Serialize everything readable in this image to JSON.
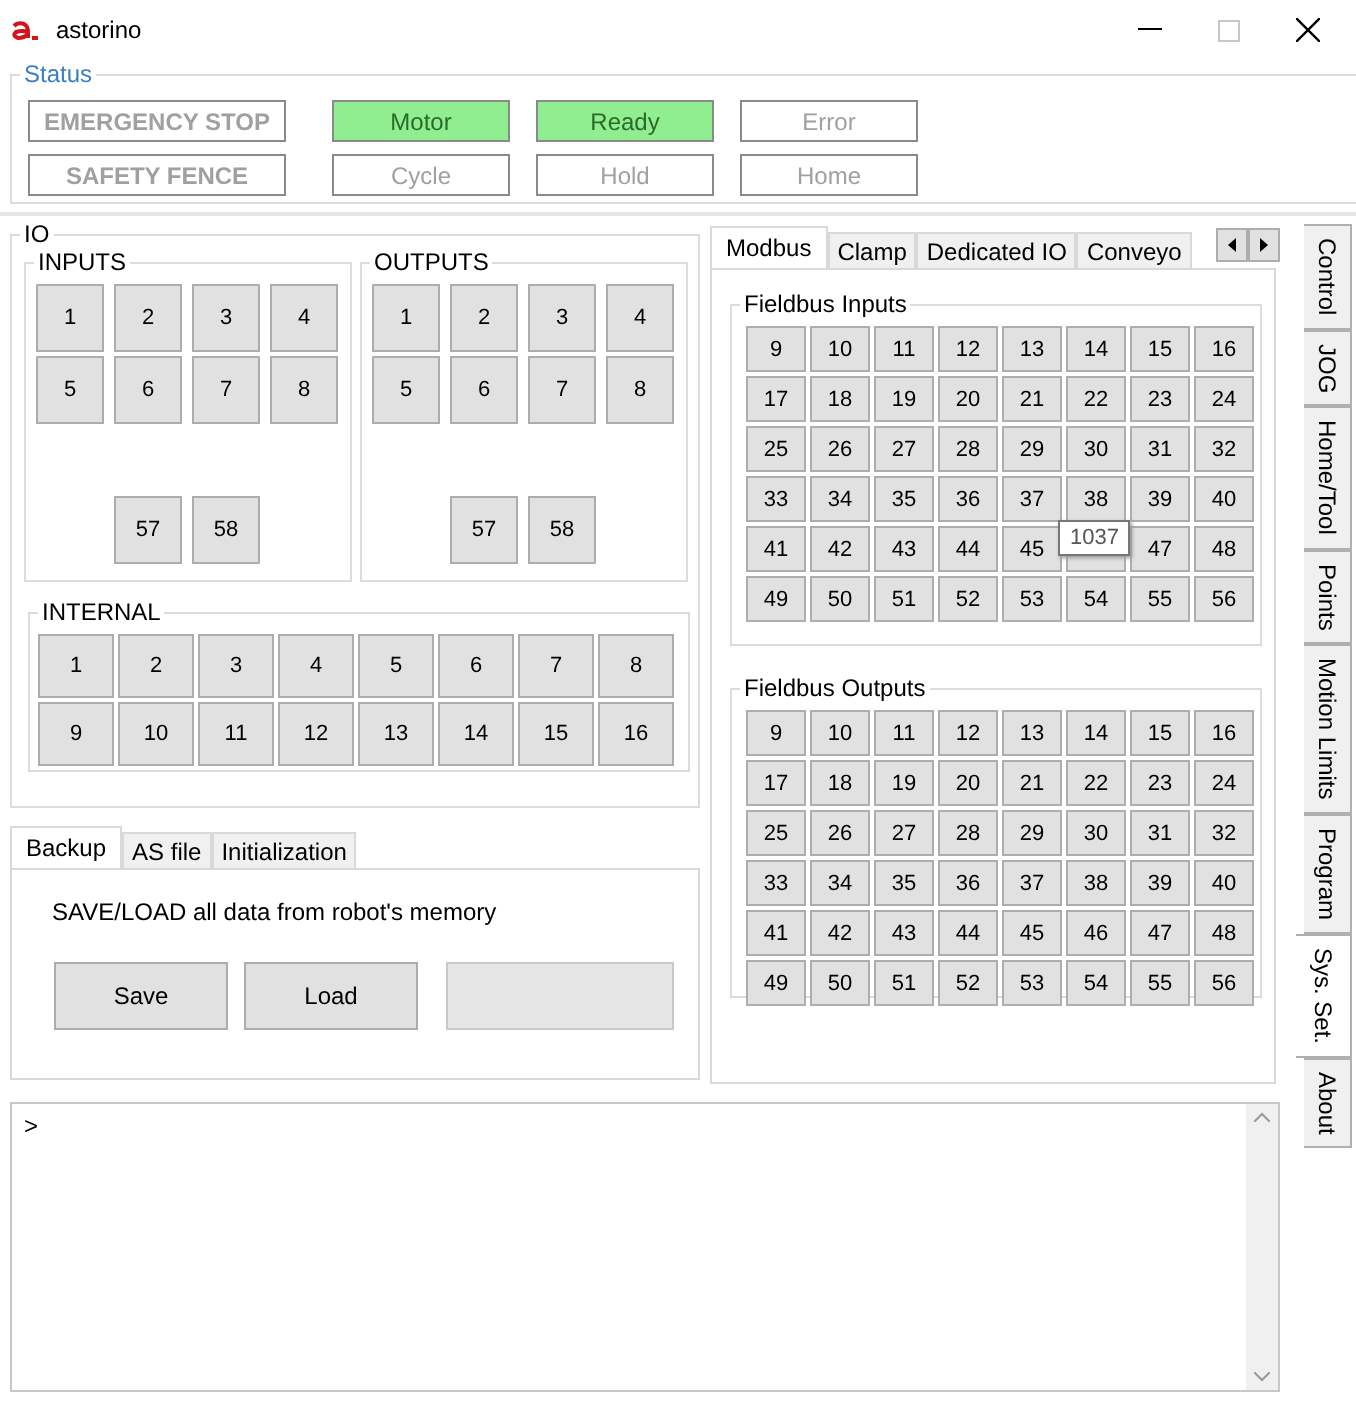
{
  "window": {
    "title": "astorino"
  },
  "status": {
    "title": "Status",
    "rows": [
      {
        "items": [
          {
            "label": "EMERGENCY STOP",
            "on": false
          },
          {
            "label": "Motor",
            "on": true
          },
          {
            "label": "Ready",
            "on": true
          },
          {
            "label": "Error",
            "on": false
          }
        ]
      },
      {
        "items": [
          {
            "label": "SAFETY FENCE",
            "on": false
          },
          {
            "label": "Cycle",
            "on": false
          },
          {
            "label": "Hold",
            "on": false
          },
          {
            "label": "Home",
            "on": false
          }
        ]
      }
    ]
  },
  "io": {
    "title": "IO",
    "inputs": {
      "title": "INPUTS",
      "buttons": [
        "1",
        "2",
        "3",
        "4",
        "5",
        "6",
        "7",
        "8"
      ],
      "extra_buttons": [
        "57",
        "58"
      ]
    },
    "outputs": {
      "title": "OUTPUTS",
      "buttons": [
        "1",
        "2",
        "3",
        "4",
        "5",
        "6",
        "7",
        "8"
      ],
      "extra_buttons": [
        "57",
        "58"
      ]
    },
    "internal": {
      "title": "INTERNAL",
      "buttons": [
        "1",
        "2",
        "3",
        "4",
        "5",
        "6",
        "7",
        "8",
        "9",
        "10",
        "11",
        "12",
        "13",
        "14",
        "15",
        "16"
      ]
    }
  },
  "backup": {
    "tabs": [
      {
        "label": "Backup",
        "selected": true
      },
      {
        "label": "AS file",
        "selected": false
      },
      {
        "label": "Initialization",
        "selected": false
      }
    ],
    "description": "SAVE/LOAD all data from robot's memory",
    "buttons": [
      "Save",
      "Load"
    ]
  },
  "modbus": {
    "tabs": [
      {
        "label": "Modbus",
        "selected": true
      },
      {
        "label": "Clamp",
        "selected": false
      },
      {
        "label": "Dedicated IO",
        "selected": false
      },
      {
        "label": "Conveyo",
        "selected": false
      }
    ],
    "fieldbus_inputs": {
      "title": "Fieldbus Inputs",
      "buttons": [
        "9",
        "10",
        "11",
        "12",
        "13",
        "14",
        "15",
        "16",
        "17",
        "18",
        "19",
        "20",
        "21",
        "22",
        "23",
        "24",
        "25",
        "26",
        "27",
        "28",
        "29",
        "30",
        "31",
        "32",
        "33",
        "34",
        "35",
        "36",
        "37",
        "38",
        "39",
        "40",
        "41",
        "42",
        "43",
        "44",
        "45",
        {
          "tooltip": "1037"
        },
        "47",
        "48",
        "49",
        "50",
        "51",
        "52",
        "53",
        "54",
        "55",
        "56"
      ]
    },
    "fieldbus_outputs": {
      "title": "Fieldbus Outputs",
      "buttons": [
        "9",
        "10",
        "11",
        "12",
        "13",
        "14",
        "15",
        "16",
        "17",
        "18",
        "19",
        "20",
        "21",
        "22",
        "23",
        "24",
        "25",
        "26",
        "27",
        "28",
        "29",
        "30",
        "31",
        "32",
        "33",
        "34",
        "35",
        "36",
        "37",
        "38",
        "39",
        "40",
        "41",
        "42",
        "43",
        "44",
        "45",
        "46",
        "47",
        "48",
        "49",
        "50",
        "51",
        "52",
        "53",
        "54",
        "55",
        "56"
      ]
    }
  },
  "side_tabs": [
    {
      "label": "Control",
      "selected": false
    },
    {
      "label": "JOG",
      "selected": false
    },
    {
      "label": "Home/Tool",
      "selected": false
    },
    {
      "label": "Points",
      "selected": false
    },
    {
      "label": "Motion Limits",
      "selected": false
    },
    {
      "label": "Program",
      "selected": false
    },
    {
      "label": "Sys. Set.",
      "selected": true
    },
    {
      "label": "About",
      "selected": false
    }
  ],
  "console": {
    "prompt": ">"
  }
}
